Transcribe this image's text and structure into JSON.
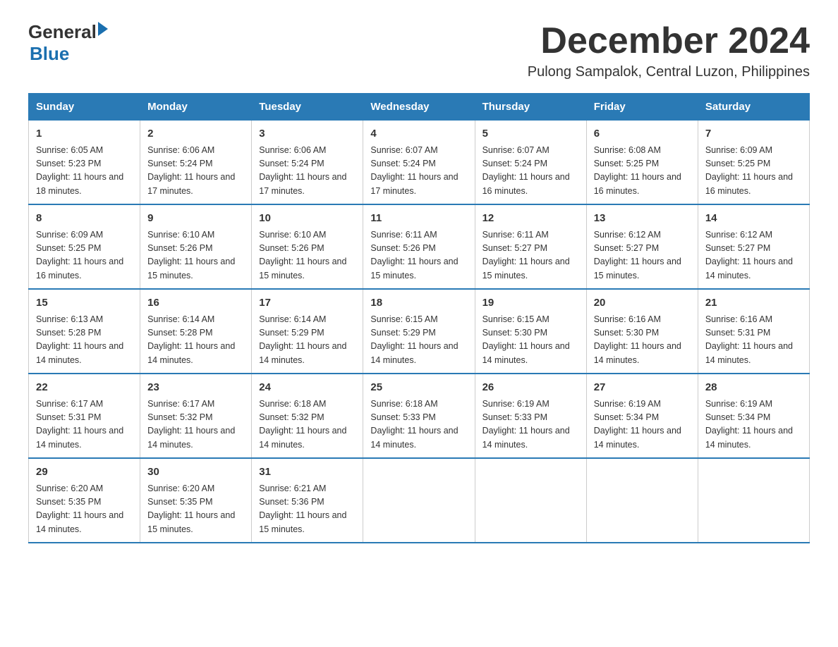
{
  "logo": {
    "general": "General",
    "blue": "Blue",
    "arrow": "▶"
  },
  "title": "December 2024",
  "subtitle": "Pulong Sampalok, Central Luzon, Philippines",
  "days_of_week": [
    "Sunday",
    "Monday",
    "Tuesday",
    "Wednesday",
    "Thursday",
    "Friday",
    "Saturday"
  ],
  "weeks": [
    [
      {
        "day": "1",
        "sunrise": "Sunrise: 6:05 AM",
        "sunset": "Sunset: 5:23 PM",
        "daylight": "Daylight: 11 hours and 18 minutes."
      },
      {
        "day": "2",
        "sunrise": "Sunrise: 6:06 AM",
        "sunset": "Sunset: 5:24 PM",
        "daylight": "Daylight: 11 hours and 17 minutes."
      },
      {
        "day": "3",
        "sunrise": "Sunrise: 6:06 AM",
        "sunset": "Sunset: 5:24 PM",
        "daylight": "Daylight: 11 hours and 17 minutes."
      },
      {
        "day": "4",
        "sunrise": "Sunrise: 6:07 AM",
        "sunset": "Sunset: 5:24 PM",
        "daylight": "Daylight: 11 hours and 17 minutes."
      },
      {
        "day": "5",
        "sunrise": "Sunrise: 6:07 AM",
        "sunset": "Sunset: 5:24 PM",
        "daylight": "Daylight: 11 hours and 16 minutes."
      },
      {
        "day": "6",
        "sunrise": "Sunrise: 6:08 AM",
        "sunset": "Sunset: 5:25 PM",
        "daylight": "Daylight: 11 hours and 16 minutes."
      },
      {
        "day": "7",
        "sunrise": "Sunrise: 6:09 AM",
        "sunset": "Sunset: 5:25 PM",
        "daylight": "Daylight: 11 hours and 16 minutes."
      }
    ],
    [
      {
        "day": "8",
        "sunrise": "Sunrise: 6:09 AM",
        "sunset": "Sunset: 5:25 PM",
        "daylight": "Daylight: 11 hours and 16 minutes."
      },
      {
        "day": "9",
        "sunrise": "Sunrise: 6:10 AM",
        "sunset": "Sunset: 5:26 PM",
        "daylight": "Daylight: 11 hours and 15 minutes."
      },
      {
        "day": "10",
        "sunrise": "Sunrise: 6:10 AM",
        "sunset": "Sunset: 5:26 PM",
        "daylight": "Daylight: 11 hours and 15 minutes."
      },
      {
        "day": "11",
        "sunrise": "Sunrise: 6:11 AM",
        "sunset": "Sunset: 5:26 PM",
        "daylight": "Daylight: 11 hours and 15 minutes."
      },
      {
        "day": "12",
        "sunrise": "Sunrise: 6:11 AM",
        "sunset": "Sunset: 5:27 PM",
        "daylight": "Daylight: 11 hours and 15 minutes."
      },
      {
        "day": "13",
        "sunrise": "Sunrise: 6:12 AM",
        "sunset": "Sunset: 5:27 PM",
        "daylight": "Daylight: 11 hours and 15 minutes."
      },
      {
        "day": "14",
        "sunrise": "Sunrise: 6:12 AM",
        "sunset": "Sunset: 5:27 PM",
        "daylight": "Daylight: 11 hours and 14 minutes."
      }
    ],
    [
      {
        "day": "15",
        "sunrise": "Sunrise: 6:13 AM",
        "sunset": "Sunset: 5:28 PM",
        "daylight": "Daylight: 11 hours and 14 minutes."
      },
      {
        "day": "16",
        "sunrise": "Sunrise: 6:14 AM",
        "sunset": "Sunset: 5:28 PM",
        "daylight": "Daylight: 11 hours and 14 minutes."
      },
      {
        "day": "17",
        "sunrise": "Sunrise: 6:14 AM",
        "sunset": "Sunset: 5:29 PM",
        "daylight": "Daylight: 11 hours and 14 minutes."
      },
      {
        "day": "18",
        "sunrise": "Sunrise: 6:15 AM",
        "sunset": "Sunset: 5:29 PM",
        "daylight": "Daylight: 11 hours and 14 minutes."
      },
      {
        "day": "19",
        "sunrise": "Sunrise: 6:15 AM",
        "sunset": "Sunset: 5:30 PM",
        "daylight": "Daylight: 11 hours and 14 minutes."
      },
      {
        "day": "20",
        "sunrise": "Sunrise: 6:16 AM",
        "sunset": "Sunset: 5:30 PM",
        "daylight": "Daylight: 11 hours and 14 minutes."
      },
      {
        "day": "21",
        "sunrise": "Sunrise: 6:16 AM",
        "sunset": "Sunset: 5:31 PM",
        "daylight": "Daylight: 11 hours and 14 minutes."
      }
    ],
    [
      {
        "day": "22",
        "sunrise": "Sunrise: 6:17 AM",
        "sunset": "Sunset: 5:31 PM",
        "daylight": "Daylight: 11 hours and 14 minutes."
      },
      {
        "day": "23",
        "sunrise": "Sunrise: 6:17 AM",
        "sunset": "Sunset: 5:32 PM",
        "daylight": "Daylight: 11 hours and 14 minutes."
      },
      {
        "day": "24",
        "sunrise": "Sunrise: 6:18 AM",
        "sunset": "Sunset: 5:32 PM",
        "daylight": "Daylight: 11 hours and 14 minutes."
      },
      {
        "day": "25",
        "sunrise": "Sunrise: 6:18 AM",
        "sunset": "Sunset: 5:33 PM",
        "daylight": "Daylight: 11 hours and 14 minutes."
      },
      {
        "day": "26",
        "sunrise": "Sunrise: 6:19 AM",
        "sunset": "Sunset: 5:33 PM",
        "daylight": "Daylight: 11 hours and 14 minutes."
      },
      {
        "day": "27",
        "sunrise": "Sunrise: 6:19 AM",
        "sunset": "Sunset: 5:34 PM",
        "daylight": "Daylight: 11 hours and 14 minutes."
      },
      {
        "day": "28",
        "sunrise": "Sunrise: 6:19 AM",
        "sunset": "Sunset: 5:34 PM",
        "daylight": "Daylight: 11 hours and 14 minutes."
      }
    ],
    [
      {
        "day": "29",
        "sunrise": "Sunrise: 6:20 AM",
        "sunset": "Sunset: 5:35 PM",
        "daylight": "Daylight: 11 hours and 14 minutes."
      },
      {
        "day": "30",
        "sunrise": "Sunrise: 6:20 AM",
        "sunset": "Sunset: 5:35 PM",
        "daylight": "Daylight: 11 hours and 15 minutes."
      },
      {
        "day": "31",
        "sunrise": "Sunrise: 6:21 AM",
        "sunset": "Sunset: 5:36 PM",
        "daylight": "Daylight: 11 hours and 15 minutes."
      },
      null,
      null,
      null,
      null
    ]
  ]
}
